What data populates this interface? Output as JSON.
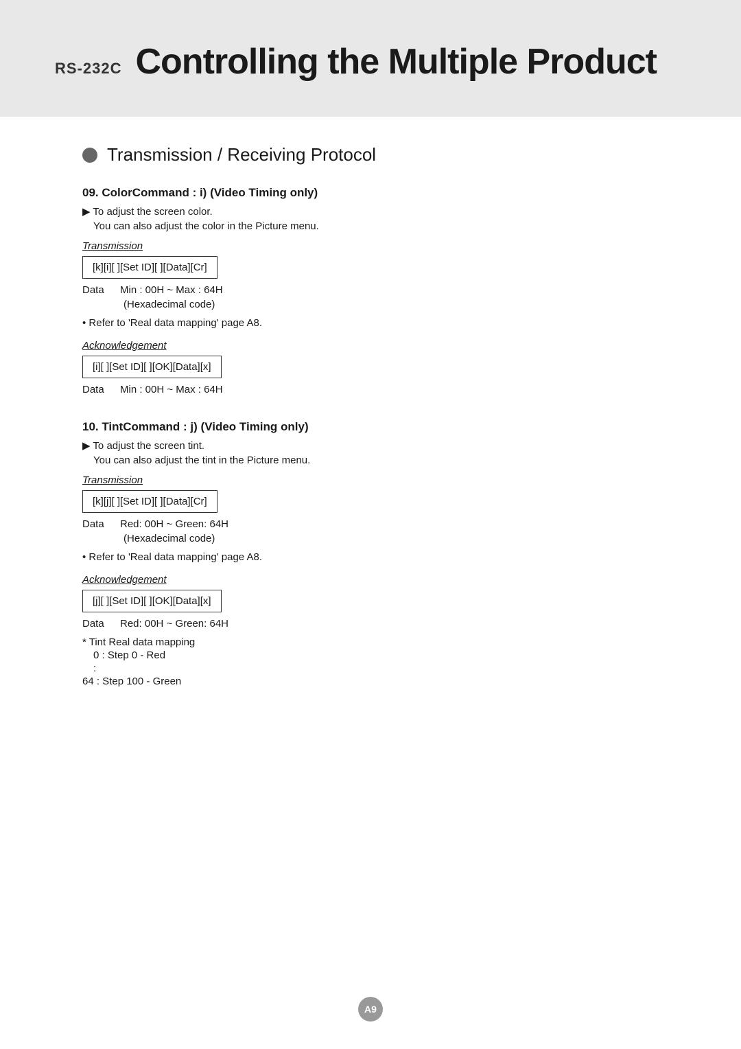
{
  "header": {
    "rs_label": "RS-232C",
    "main_title": "Controlling the Multiple Product"
  },
  "protocol": {
    "title": "Transmission / Receiving Protocol"
  },
  "section9": {
    "title": "09. ColorCommand : i) (Video Timing only)",
    "desc1": "▶ To adjust the screen color.",
    "desc2": "You can also adjust the color in the Picture menu.",
    "transmission_label": "Transmission",
    "transmission_code": "[k][i][  ][Set ID][  ][Data][Cr]",
    "data_label": "Data",
    "data_range": "Min : 00H ~ Max : 64H",
    "data_note": "(Hexadecimal code)",
    "refer": "• Refer to 'Real data mapping' page A8.",
    "ack_label": "Acknowledgement",
    "ack_code": "[i][  ][Set ID][  ][OK][Data][x]",
    "ack_data_label": "Data",
    "ack_data_range": "Min : 00H ~ Max : 64H"
  },
  "section10": {
    "title": "10. TintCommand : j) (Video Timing only)",
    "desc1": "▶ To adjust the screen tint.",
    "desc2": "You can also adjust the tint in the Picture menu.",
    "transmission_label": "Transmission",
    "transmission_code": "[k][j][  ][Set ID][  ][Data][Cr]",
    "data_label": "Data",
    "data_range": "Red: 00H ~ Green: 64H",
    "data_note": "(Hexadecimal code)",
    "refer": "• Refer to 'Real data mapping' page A8.",
    "ack_label": "Acknowledgement",
    "ack_code": "[j][  ][Set ID][  ][OK][Data][x]",
    "ack_data_label": "Data",
    "ack_data_range": "Red: 00H ~ Green: 64H",
    "note1": "* Tint Real data mapping",
    "note2": "0 : Step 0 - Red",
    "note3": ":",
    "note4": "64 : Step 100 - Green"
  },
  "page_number": "A9"
}
